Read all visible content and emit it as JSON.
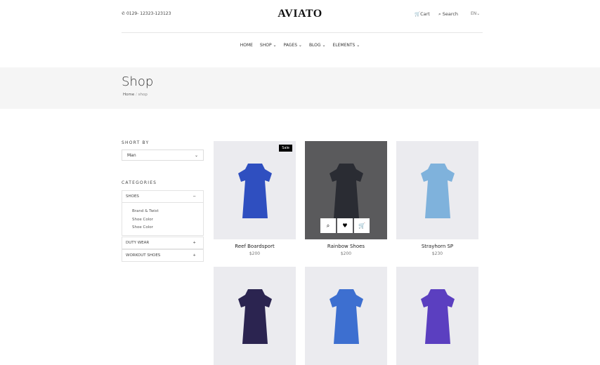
{
  "header": {
    "phone": "0129- 12323-123123",
    "logo": "AVIATO",
    "cart": "Cart",
    "search": "Search",
    "lang": "EN"
  },
  "nav": [
    "HOME",
    "SHOP",
    "PAGES",
    "BLOG",
    "ELEMENTS"
  ],
  "page": {
    "title": "Shop",
    "breadcrumb": [
      "Home",
      "shop"
    ]
  },
  "sidebar": {
    "sort_label": "SHORT BY",
    "sort_value": "Man",
    "categories_label": "CATEGORIES",
    "categories": [
      {
        "label": "SHOES",
        "toggle": "−",
        "items": [
          "Brand & Twist",
          "Shoe Color",
          "Shoe Color"
        ]
      },
      {
        "label": "DUTY WEAR",
        "toggle": "+"
      },
      {
        "label": "WORKOUT SHOES",
        "toggle": "+"
      }
    ]
  },
  "products": [
    {
      "name": "Reef Boardsport",
      "price": "$200",
      "badge": "Sale",
      "color": "#2f4fc0"
    },
    {
      "name": "Rainbow Shoes",
      "price": "$200",
      "color": "#2a2c33"
    },
    {
      "name": "Strayhorn SP",
      "price": "$230",
      "color": "#7fb2dc"
    },
    {
      "color": "#2b2450"
    },
    {
      "color": "#3d6fd0"
    },
    {
      "color": "#5b3fc0"
    }
  ]
}
